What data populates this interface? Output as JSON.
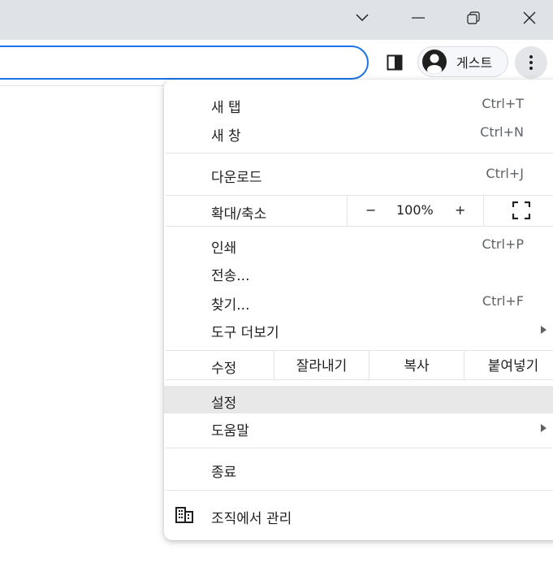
{
  "window": {
    "controls": [
      "tab-search",
      "minimize",
      "restore",
      "close"
    ]
  },
  "toolbar": {
    "profile_label": "게스트"
  },
  "menu": {
    "new_tab": {
      "label": "새 탭",
      "shortcut": "Ctrl+T"
    },
    "new_window": {
      "label": "새 창",
      "shortcut": "Ctrl+N"
    },
    "downloads": {
      "label": "다운로드",
      "shortcut": "Ctrl+J"
    },
    "zoom": {
      "label": "확대/축소",
      "minus": "−",
      "value": "100%",
      "plus": "+"
    },
    "print": {
      "label": "인쇄",
      "shortcut": "Ctrl+P"
    },
    "cast": {
      "label": "전송..."
    },
    "find": {
      "label": "찾기...",
      "shortcut": "Ctrl+F"
    },
    "more_tools": {
      "label": "도구 더보기"
    },
    "edit": {
      "label": "수정",
      "cut": "잘라내기",
      "copy": "복사",
      "paste": "붙여넣기"
    },
    "settings": {
      "label": "설정"
    },
    "help": {
      "label": "도움말"
    },
    "exit": {
      "label": "종료"
    },
    "managed": {
      "label": "조직에서 관리"
    }
  },
  "colors": {
    "accent": "#1a73e8",
    "titlebar": "#dfe3e8",
    "hover": "#e8e8e8"
  }
}
